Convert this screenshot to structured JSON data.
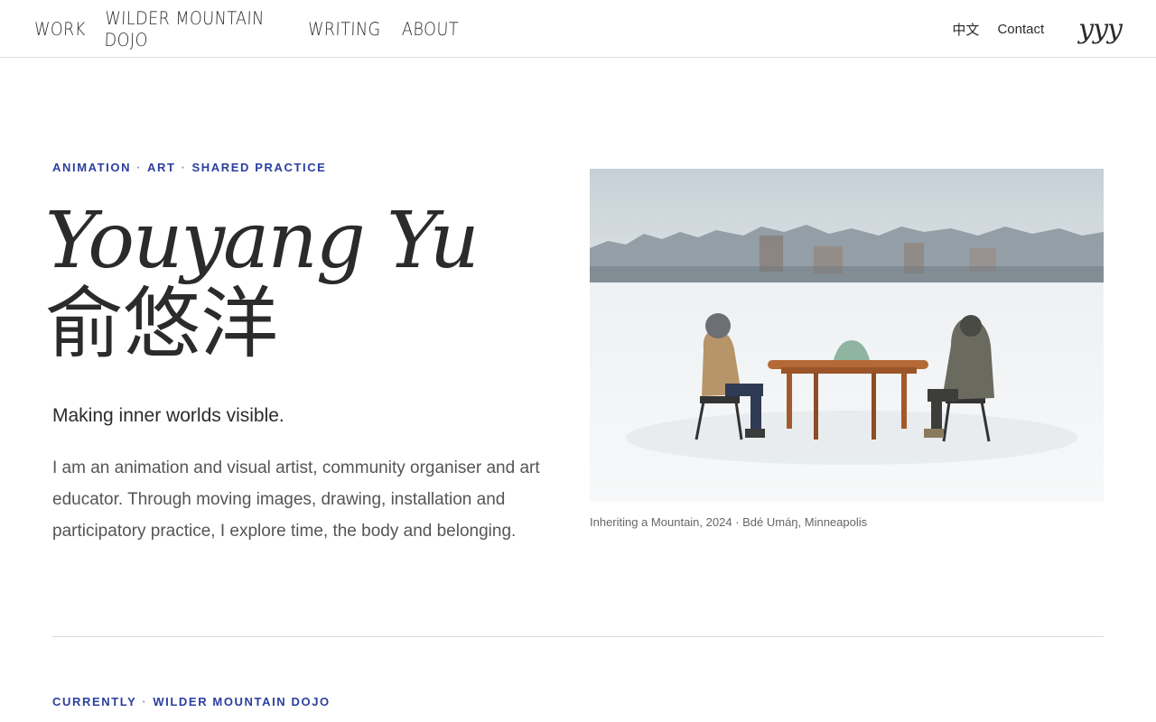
{
  "nav": {
    "primary": [
      {
        "label": "WORK"
      },
      {
        "label": "WILDER MOUNTAIN DOJO"
      },
      {
        "label": "WRITING"
      },
      {
        "label": "ABOUT"
      }
    ],
    "language_label": "中文",
    "contact_label": "Contact",
    "logo_text": "yyy"
  },
  "hero": {
    "eyebrow": [
      "ANIMATION",
      "ART",
      "SHARED PRACTICE"
    ],
    "eyebrow_separator": "·",
    "name_latin": "Youyang Yu",
    "name_cjk": "俞悠洋",
    "tagline": "Making inner worlds visible.",
    "intro": "I am an animation and visual artist, community organiser and art educator. Through moving images, drawing, installation and participatory practice, I explore time, the body and belonging."
  },
  "figure": {
    "caption": "Inheriting a Mountain, 2024 · Bdé Umáŋ, Minneapolis",
    "subject": "two people in winter coats seated at a wooden table on a frozen lake, city skyline in background"
  },
  "currently": {
    "labels": [
      "CURRENTLY",
      "WILDER MOUNTAIN DOJO"
    ],
    "separator": "·"
  },
  "colors": {
    "accent": "#2a3f9e",
    "text": "#2b2b2b",
    "muted": "#555555",
    "divider": "#dcdcdc"
  }
}
